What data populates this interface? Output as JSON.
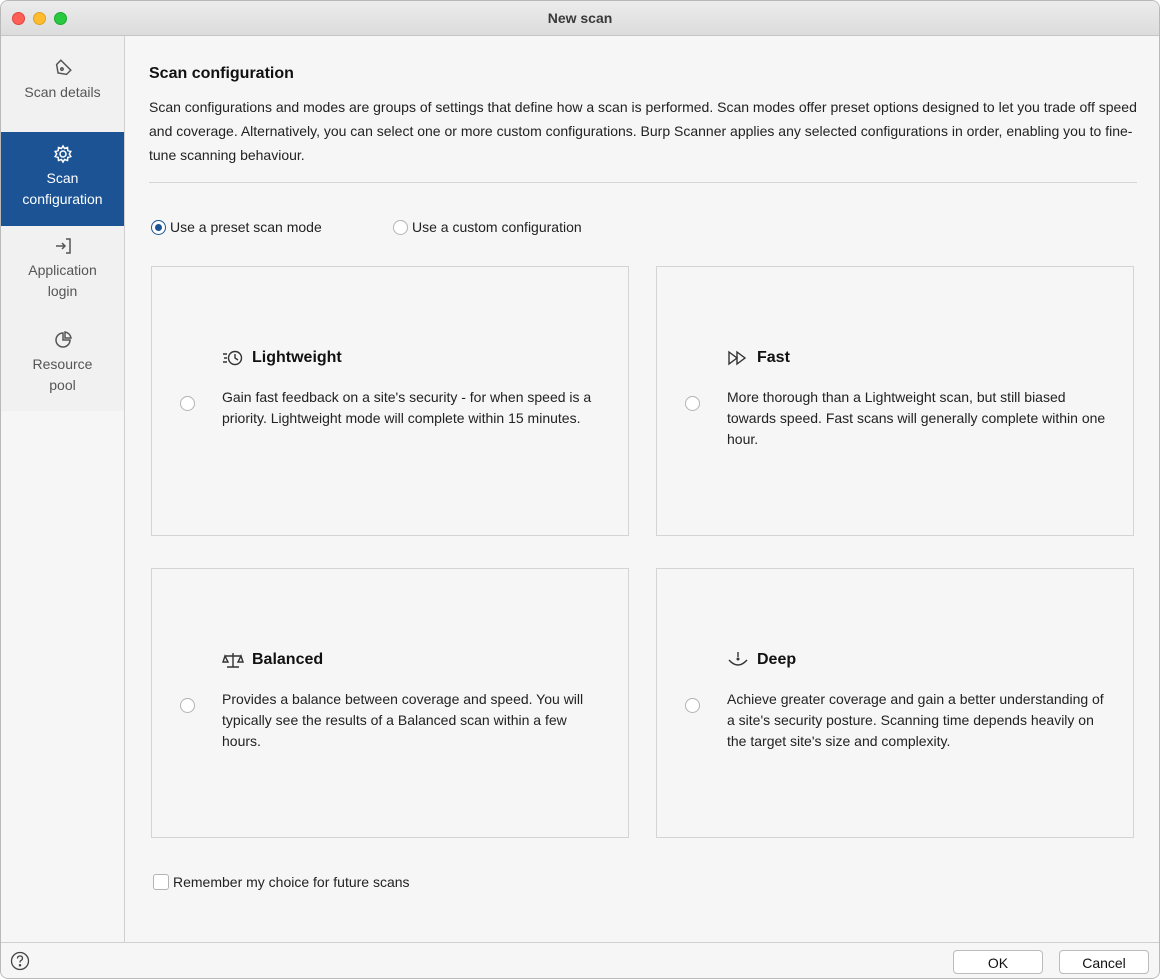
{
  "window": {
    "title": "New scan"
  },
  "sidebar": {
    "items": [
      {
        "label": "Scan details",
        "icon": "tag-icon",
        "active": false
      },
      {
        "label": "Scan configuration",
        "icon": "gear-icon",
        "active": true
      },
      {
        "label": "Application login",
        "icon": "login-icon",
        "active": false
      },
      {
        "label": "Resource pool",
        "icon": "pie-chart-icon",
        "active": false
      }
    ]
  },
  "main": {
    "heading": "Scan configuration",
    "description": "Scan configurations and modes are groups of settings that define how a scan is performed. Scan modes offer preset options designed to let you trade off speed and coverage. Alternatively, you can select one or more custom configurations. Burp Scanner applies any selected configurations in order, enabling you to fine-tune scanning behaviour.",
    "mode_options": [
      {
        "label": "Use a preset scan mode",
        "selected": true
      },
      {
        "label": "Use a custom configuration",
        "selected": false
      }
    ],
    "cards": [
      {
        "title": "Lightweight",
        "icon": "clock-speed-icon",
        "text": "Gain fast feedback on a site's security - for when speed is a priority. Lightweight mode will complete within 15 minutes.",
        "selected": false
      },
      {
        "title": "Fast",
        "icon": "fast-forward-icon",
        "text": "More thorough than a Lightweight scan, but still biased towards speed. Fast scans will generally complete within one hour.",
        "selected": false
      },
      {
        "title": "Balanced",
        "icon": "scales-icon",
        "text": "Provides a balance between coverage and speed. You will typically see the results of a Balanced scan within a few hours.",
        "selected": false
      },
      {
        "title": "Deep",
        "icon": "dive-icon",
        "text": "Achieve greater coverage and gain a better understanding of a site's security posture. Scanning time depends heavily on the target site's size and complexity.",
        "selected": false
      }
    ],
    "remember_label": "Remember my choice for future scans"
  },
  "footer": {
    "ok_label": "OK",
    "cancel_label": "Cancel"
  },
  "colors": {
    "accent": "#1b5394"
  }
}
